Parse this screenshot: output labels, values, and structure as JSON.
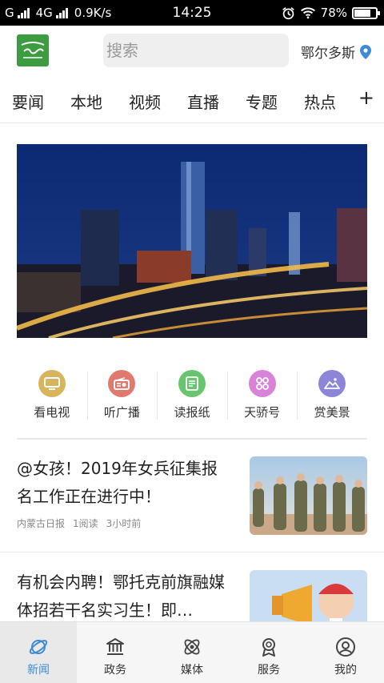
{
  "status_bar": {
    "carrier1": "G",
    "carrier2": "4G",
    "speed": "0.9K/s",
    "time": "14:25",
    "battery": "78%",
    "battery_level": 0.78,
    "icons": [
      "alarm-icon",
      "wifi-icon",
      "battery-icon"
    ]
  },
  "header": {
    "logo_icon": "app-logo-icon",
    "search_placeholder": "搜索",
    "location": "鄂尔多斯",
    "location_icon": "location-pin-icon"
  },
  "tabs": [
    "要闻",
    "本地",
    "视频",
    "直播",
    "专题",
    "热点"
  ],
  "tabs_more_label": "+",
  "services": [
    {
      "label": "看电视",
      "icon": "tv-icon",
      "color": "#d8b45c"
    },
    {
      "label": "听广播",
      "icon": "radio-icon",
      "color": "#e07a6e"
    },
    {
      "label": "读报纸",
      "icon": "newspaper-icon",
      "color": "#67c66d"
    },
    {
      "label": "天骄号",
      "icon": "apps-icon",
      "color": "#d983d8"
    },
    {
      "label": "赏美景",
      "icon": "landscape-icon",
      "color": "#8d86d8"
    }
  ],
  "news": [
    {
      "title": "@女孩！2019年女兵征集报名工作正在进行中！",
      "source": "内蒙古日报",
      "reads": "1阅读",
      "time": "3小时前"
    },
    {
      "title": "有机会内聘！鄂托克前旗融媒体招若干名实习生！即…"
    }
  ],
  "bottom_nav": [
    {
      "label": "新闻",
      "icon": "planet-icon",
      "active": true
    },
    {
      "label": "政务",
      "icon": "government-icon",
      "active": false
    },
    {
      "label": "媒体",
      "icon": "atom-icon",
      "active": false
    },
    {
      "label": "服务",
      "icon": "service-badge-icon",
      "active": false
    },
    {
      "label": "我的",
      "icon": "profile-icon",
      "active": false
    }
  ],
  "colors": {
    "accent": "#3f8ad6",
    "logo_green": "#3d9b40"
  }
}
